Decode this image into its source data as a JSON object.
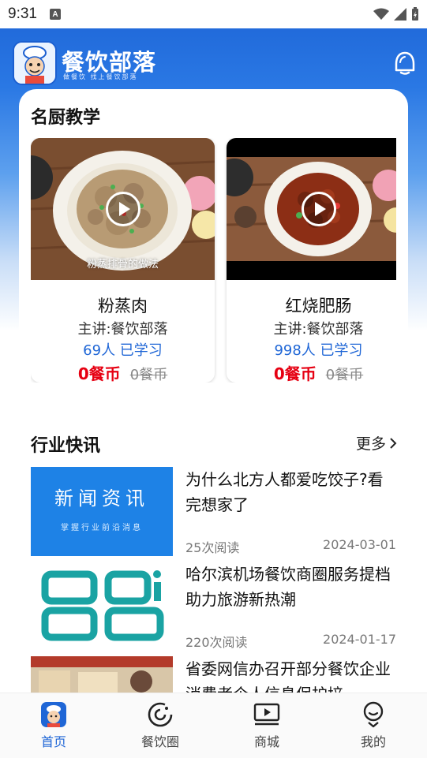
{
  "status_bar": {
    "time": "9:31",
    "notification_icon": "A"
  },
  "app_bar": {
    "logo_title": "餐饮部落",
    "logo_subtitle": "做餐饮  找上餐饮部落",
    "bell_icon": "bell-icon"
  },
  "courses": {
    "title": "名厨教学",
    "items": [
      {
        "name": "粉蒸肉",
        "thumb_caption": "粉蒸排骨的做法",
        "teacher": "主讲:餐饮部落",
        "learned": "69人 已学习",
        "price_now": "0餐币",
        "price_old": "0餐币"
      },
      {
        "name": "红烧肥肠",
        "thumb_caption": "",
        "teacher": "主讲:餐饮部落",
        "learned": "998人 已学习",
        "price_now": "0餐币",
        "price_old": "0餐币"
      }
    ]
  },
  "news": {
    "title": "行业快讯",
    "more_label": "更多",
    "items": [
      {
        "thumb_title": "新闻资讯",
        "thumb_sub": "掌握行业前沿消息",
        "title": "为什么北方人都爱吃饺子?看完想家了",
        "reads": "25次阅读",
        "date": "2024-03-01"
      },
      {
        "thumb_title": "",
        "thumb_sub": "",
        "title": "哈尔滨机场餐饮商圈服务提档 助力旅游新热潮",
        "reads": "220次阅读",
        "date": "2024-01-17"
      },
      {
        "thumb_title": "",
        "thumb_sub": "",
        "title": "省委网信办召开部分餐饮企业消费者个人信息保护培",
        "reads": "",
        "date": ""
      }
    ]
  },
  "bottom_nav": {
    "items": [
      {
        "label": "首页",
        "icon": "chef-home-icon",
        "active": true
      },
      {
        "label": "餐饮圈",
        "icon": "circle-refresh-icon",
        "active": false
      },
      {
        "label": "商城",
        "icon": "play-screen-icon",
        "active": false
      },
      {
        "label": "我的",
        "icon": "user-icon",
        "active": false
      }
    ]
  },
  "colors": {
    "brand_blue": "#1f66d6",
    "price_red": "#e60012",
    "news_thumb_blue": "#1e82e6"
  }
}
